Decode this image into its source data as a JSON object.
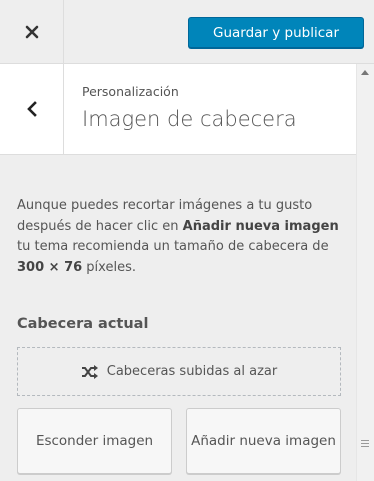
{
  "topbar": {
    "close_icon": "close-x-icon",
    "save_label": "Guardar y publicar"
  },
  "section": {
    "back_icon": "chevron-left-icon",
    "meta": "Personalización",
    "title": "Imagen de cabecera"
  },
  "description": {
    "part1": "Aunque puedes recortar imágenes a tu gusto después de hacer clic en ",
    "bold1": "Añadir nueva imagen",
    "part2": " tu tema recomienda un tamaño de cabecera de ",
    "bold2": "300 × 76",
    "part3": " píxeles."
  },
  "current_header": {
    "label": "Cabecera actual",
    "random_icon": "shuffle-icon",
    "random_label": "Cabeceras subidas al azar"
  },
  "actions": {
    "hide_label": "Esconder imagen",
    "add_label": "Añadir nueva imagen"
  },
  "colors": {
    "primary": "#0085ba",
    "panel_bg": "#eeeeee"
  }
}
